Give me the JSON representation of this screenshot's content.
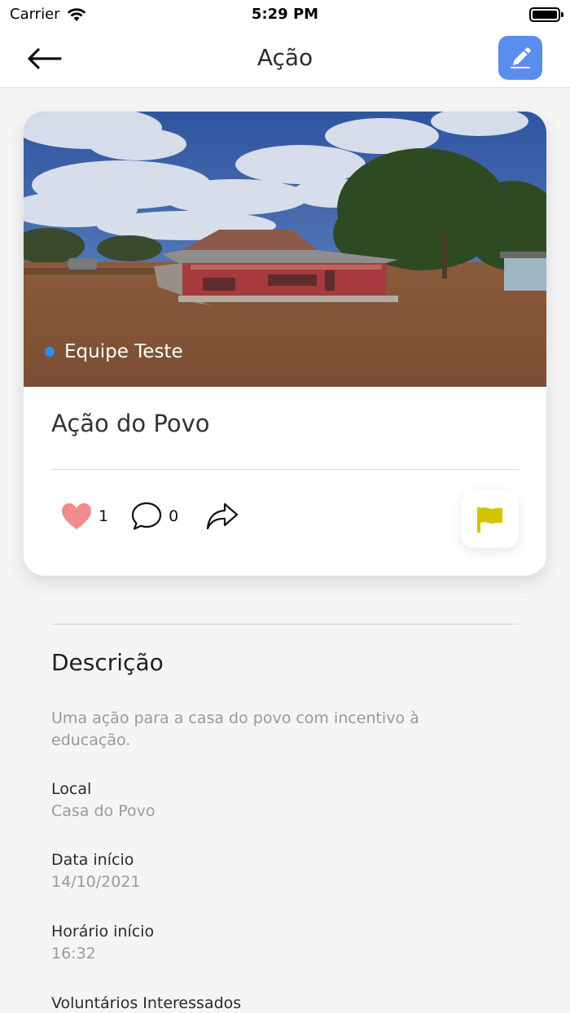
{
  "status_bar": {
    "carrier": "Carrier",
    "time": "5:29 PM"
  },
  "nav": {
    "title": "Ação",
    "back_icon": "arrow-left-icon",
    "edit_icon": "pencil-icon"
  },
  "card": {
    "team": "Equipe Teste",
    "title": "Ação do Povo",
    "likes": "1",
    "comments": "0",
    "colors": {
      "like": "#f28b8b",
      "flag": "#d4c400",
      "edit_bg": "#5b8def",
      "team_dot": "#2e8cf0"
    }
  },
  "details": {
    "description_heading": "Descrição",
    "description_text": "Uma ação para a casa do povo com incentivo à educação.",
    "local_label": "Local",
    "local_value": "Casa do Povo",
    "date_label": "Data início",
    "date_value": "14/10/2021",
    "time_label": "Horário início",
    "time_value": "16:32",
    "volunteers_label": "Voluntários Interessados"
  }
}
